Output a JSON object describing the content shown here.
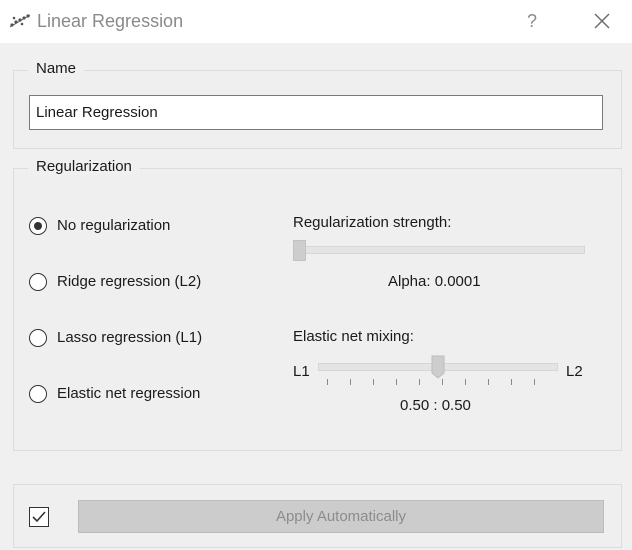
{
  "window": {
    "title": "Linear Regression",
    "help_glyph": "?",
    "app_icon": "scatter-plot-icon",
    "close_icon": "close-icon"
  },
  "name_box": {
    "title": "Name",
    "value": "Linear Regression"
  },
  "regularization": {
    "title": "Regularization",
    "options": [
      {
        "label": "No regularization",
        "checked": true
      },
      {
        "label": "Ridge regression (L2)",
        "checked": false
      },
      {
        "label": "Lasso regression (L1)",
        "checked": false
      },
      {
        "label": "Elastic net regression",
        "checked": false
      }
    ],
    "strength": {
      "label": "Regularization strength:",
      "alpha_text": "Alpha: 0.0001",
      "level": 0
    },
    "mixing": {
      "label": "Elastic net mixing:",
      "left_label": "L1",
      "right_label": "L2",
      "ratio_text": "0.50 : 0.50",
      "level": 0.5
    }
  },
  "bottom": {
    "apply_label": "Apply Automatically",
    "auto_apply_checked": true
  }
}
